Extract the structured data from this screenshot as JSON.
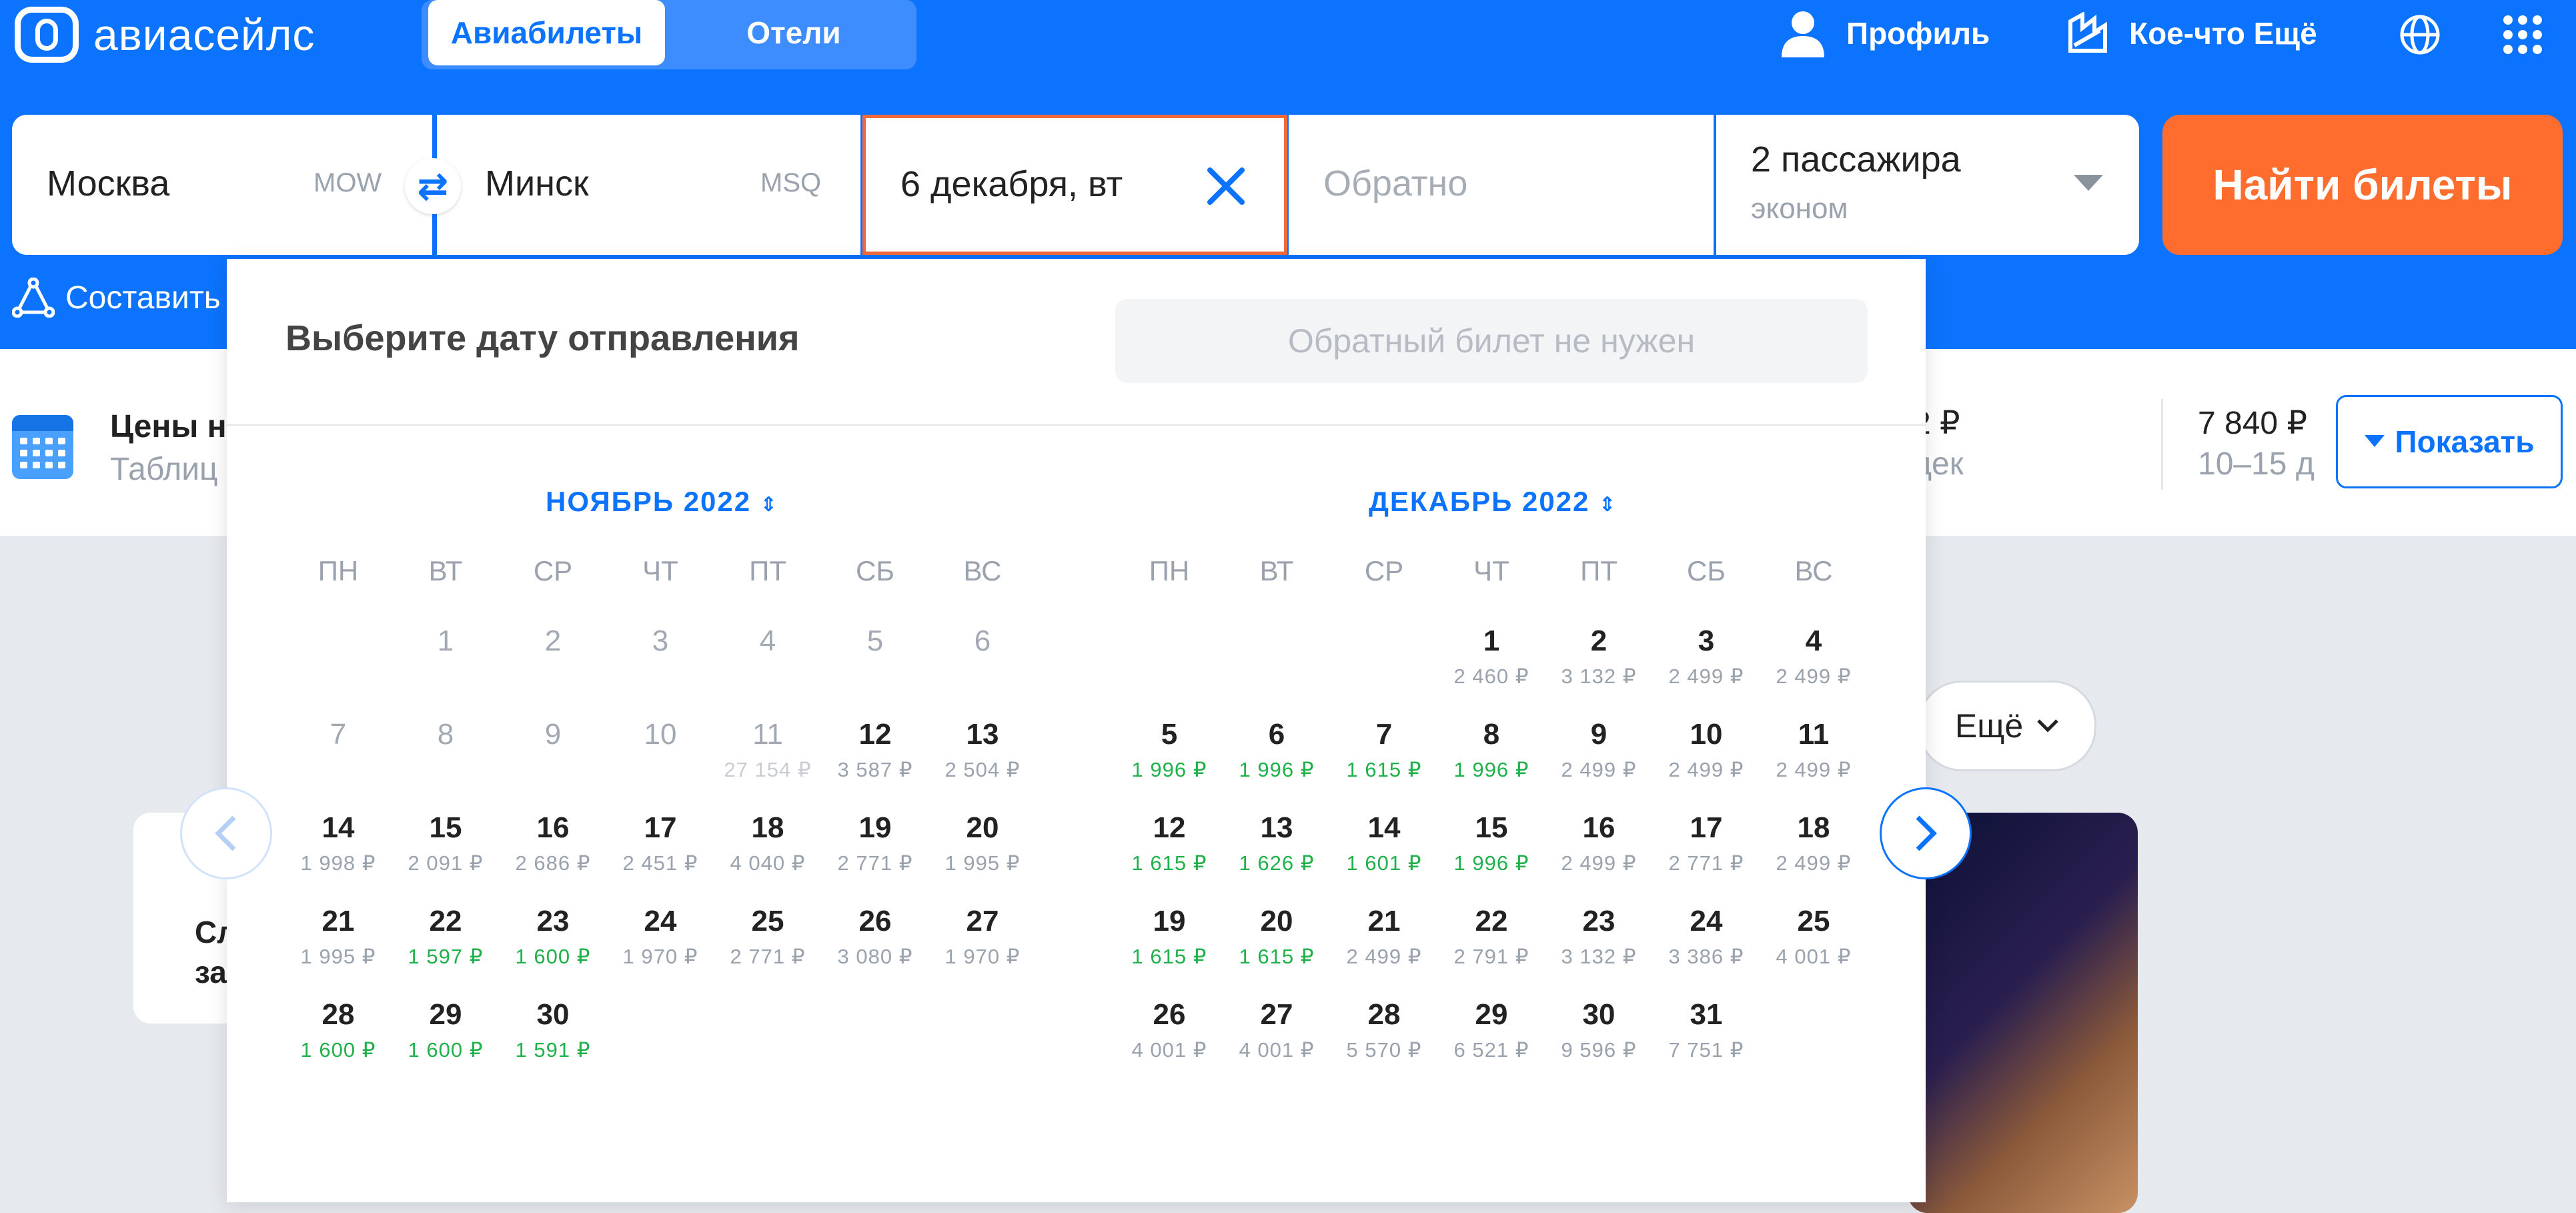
{
  "brand": "авиасейлс",
  "tabs": {
    "active": "Авиабилеты",
    "other": "Отели"
  },
  "nav": {
    "profile": "Профиль",
    "more": "Кое-что Ещё"
  },
  "search": {
    "origin": {
      "city": "Москва",
      "code": "MOW"
    },
    "destination": {
      "city": "Минск",
      "code": "MSQ"
    },
    "depart_date": "6 декабря, вт",
    "return_placeholder": "Обратно",
    "passengers": "2 пассажира",
    "cabin": "эконом",
    "find_button": "Найти билеты"
  },
  "route_link": "Составить",
  "prices_strip": {
    "title": "Цены н",
    "subtitle": "Таблиц",
    "mid_price": "2 ₽",
    "mid_date": "дек",
    "right_price": "7 840 ₽",
    "right_dates": "10–15 д",
    "show_button": "Показать"
  },
  "background": {
    "more_pill": "Ещё",
    "card_line1": "Сл",
    "card_line2": "за"
  },
  "calendar": {
    "title": "Выберите дату отправления",
    "oneway_button": "Обратный билет не нужен",
    "weekdays": [
      "ПН",
      "ВТ",
      "СР",
      "ЧТ",
      "ПТ",
      "СБ",
      "ВС"
    ],
    "months": [
      {
        "title": "НОЯБРЬ 2022",
        "days": [
          {
            "n": "1",
            "past": true
          },
          {
            "n": "2",
            "past": true
          },
          {
            "n": "3",
            "past": true
          },
          {
            "n": "4",
            "past": true
          },
          {
            "n": "5",
            "past": true
          },
          {
            "n": "6",
            "past": true
          },
          {
            "n": "7",
            "past": true
          },
          {
            "n": "8",
            "past": true
          },
          {
            "n": "9",
            "past": true
          },
          {
            "n": "10",
            "past": true
          },
          {
            "n": "11",
            "past": true,
            "p": "27 154 ₽",
            "faded": true
          },
          {
            "n": "12",
            "p": "3 587 ₽"
          },
          {
            "n": "13",
            "p": "2 504 ₽"
          },
          {
            "n": "14",
            "p": "1 998 ₽"
          },
          {
            "n": "15",
            "p": "2 091 ₽"
          },
          {
            "n": "16",
            "p": "2 686 ₽"
          },
          {
            "n": "17",
            "p": "2 451 ₽"
          },
          {
            "n": "18",
            "p": "4 040 ₽"
          },
          {
            "n": "19",
            "p": "2 771 ₽"
          },
          {
            "n": "20",
            "p": "1 995 ₽"
          },
          {
            "n": "21",
            "p": "1 995 ₽"
          },
          {
            "n": "22",
            "p": "1 597 ₽",
            "green": true
          },
          {
            "n": "23",
            "p": "1 600 ₽",
            "green": true
          },
          {
            "n": "24",
            "p": "1 970 ₽"
          },
          {
            "n": "25",
            "p": "2 771 ₽"
          },
          {
            "n": "26",
            "p": "3 080 ₽"
          },
          {
            "n": "27",
            "p": "1 970 ₽"
          },
          {
            "n": "28",
            "p": "1 600 ₽",
            "green": true
          },
          {
            "n": "29",
            "p": "1 600 ₽",
            "green": true
          },
          {
            "n": "30",
            "p": "1 591 ₽",
            "green": true
          }
        ]
      },
      {
        "title": "ДЕКАБРЬ 2022",
        "days": [
          {
            "n": "1",
            "p": "2 460 ₽"
          },
          {
            "n": "2",
            "p": "3 132 ₽"
          },
          {
            "n": "3",
            "p": "2 499 ₽"
          },
          {
            "n": "4",
            "p": "2 499 ₽"
          },
          {
            "n": "5",
            "p": "1 996 ₽",
            "green": true
          },
          {
            "n": "6",
            "p": "1 996 ₽",
            "green": true
          },
          {
            "n": "7",
            "p": "1 615 ₽",
            "green": true
          },
          {
            "n": "8",
            "p": "1 996 ₽",
            "green": true
          },
          {
            "n": "9",
            "p": "2 499 ₽"
          },
          {
            "n": "10",
            "p": "2 499 ₽"
          },
          {
            "n": "11",
            "p": "2 499 ₽"
          },
          {
            "n": "12",
            "p": "1 615 ₽",
            "green": true
          },
          {
            "n": "13",
            "p": "1 626 ₽",
            "green": true
          },
          {
            "n": "14",
            "p": "1 601 ₽",
            "green": true
          },
          {
            "n": "15",
            "p": "1 996 ₽",
            "green": true
          },
          {
            "n": "16",
            "p": "2 499 ₽"
          },
          {
            "n": "17",
            "p": "2 771 ₽"
          },
          {
            "n": "18",
            "p": "2 499 ₽"
          },
          {
            "n": "19",
            "p": "1 615 ₽",
            "green": true
          },
          {
            "n": "20",
            "p": "1 615 ₽",
            "green": true
          },
          {
            "n": "21",
            "p": "2 499 ₽"
          },
          {
            "n": "22",
            "p": "2 791 ₽"
          },
          {
            "n": "23",
            "p": "3 132 ₽"
          },
          {
            "n": "24",
            "p": "3 386 ₽"
          },
          {
            "n": "25",
            "p": "4 001 ₽"
          },
          {
            "n": "26",
            "p": "4 001 ₽"
          },
          {
            "n": "27",
            "p": "4 001 ₽"
          },
          {
            "n": "28",
            "p": "5 570 ₽"
          },
          {
            "n": "29",
            "p": "6 521 ₽"
          },
          {
            "n": "30",
            "p": "9 596 ₽"
          },
          {
            "n": "31",
            "p": "7 751 ₽"
          }
        ]
      }
    ]
  },
  "colors": {
    "brand_blue": "#0c73fe",
    "accent_orange": "#ff6d2e",
    "cheap_green": "#1fb14a"
  }
}
